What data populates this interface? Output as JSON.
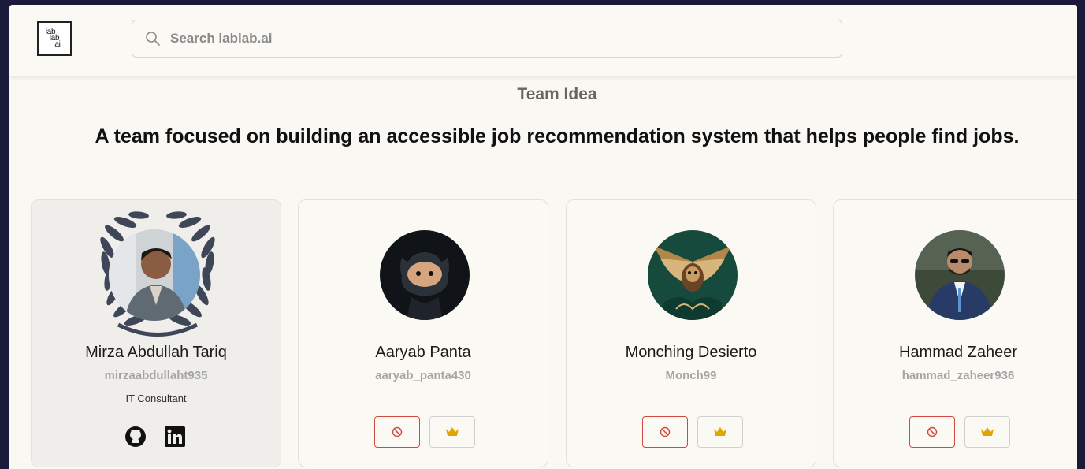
{
  "header": {
    "logo_lines": [
      "lab",
      "lab",
      "ai"
    ],
    "search_placeholder": "Search lablab.ai"
  },
  "section_label": "Team Idea",
  "team_idea": "A team focused on building an accessible job recommendation system that helps people find jobs.",
  "colors": {
    "remove_border": "#d24a3f",
    "crown": "#e2a400",
    "card_bg": "#fbf9f4",
    "active_card_bg": "#efeeeb"
  },
  "members": [
    {
      "name": "Mirza Abdullah Tariq",
      "username": "mirzaabdullaht935",
      "title": "IT Consultant",
      "icons": [
        "laurel-wreath-icon",
        "github-icon",
        "linkedin-icon"
      ]
    },
    {
      "name": "Aaryab Panta",
      "username": "aaryab_panta430",
      "icons": [
        "ban-icon",
        "crown-icon"
      ]
    },
    {
      "name": "Monching Desierto",
      "username": "Monch99",
      "icons": [
        "ban-icon",
        "crown-icon"
      ]
    },
    {
      "name": "Hammad Zaheer",
      "username": "hammad_zaheer936",
      "icons": [
        "ban-icon",
        "crown-icon"
      ]
    }
  ]
}
